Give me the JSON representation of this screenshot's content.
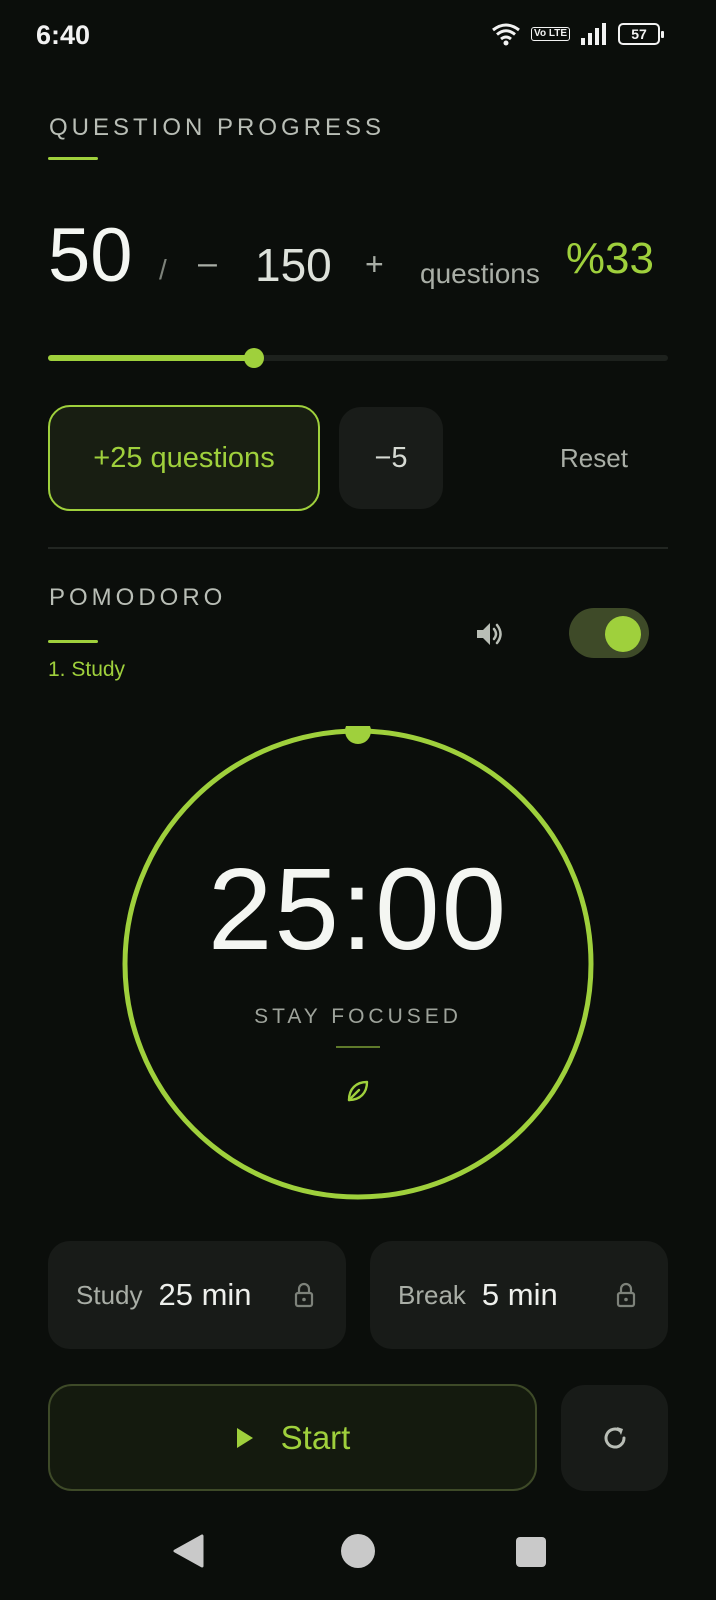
{
  "status_bar": {
    "time": "6:40",
    "volte": "Vo LTE",
    "battery": "57"
  },
  "question_progress": {
    "title": "QUESTION PROGRESS",
    "completed": "50",
    "slash": "/",
    "minus_label": "–",
    "total": "150",
    "plus_label": "+",
    "unit": "questions",
    "percent_label": "%33",
    "progress_fraction": 0.333,
    "add_button_label": "+25 questions",
    "minus_button_label": "−5",
    "reset_label": "Reset"
  },
  "pomodoro": {
    "title": "POMODORO",
    "phase": "1. Study",
    "sound_enabled": true,
    "timer": "25:00",
    "subtitle": "STAY FOCUSED",
    "remaining_fraction": 1.0,
    "study_card": {
      "label": "Study",
      "value": "25 min"
    },
    "break_card": {
      "label": "Break",
      "value": "5 min"
    },
    "start_label": "Start"
  },
  "icons": {
    "sound": "speaker-icon",
    "leaf": "leaf-icon",
    "lock": "lock-icon",
    "play": "play-icon",
    "restart": "restart-icon"
  },
  "colors": {
    "accent": "#9fd03c",
    "background": "#0b0e0b",
    "card": "#181b18"
  }
}
